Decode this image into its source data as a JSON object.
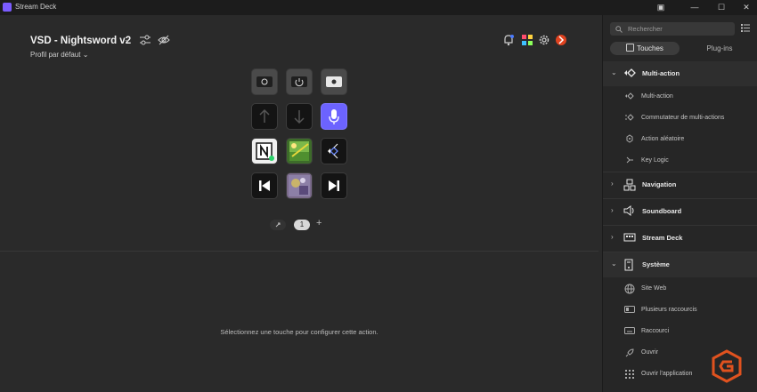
{
  "app": {
    "title": "Stream Deck"
  },
  "window_controls": [
    {
      "name": "compact-mode-icon",
      "glyph": "▣"
    },
    {
      "name": "minimize-icon",
      "glyph": "—"
    },
    {
      "name": "maximize-icon",
      "glyph": "☐"
    },
    {
      "name": "close-icon",
      "glyph": "✕"
    }
  ],
  "profile": {
    "name": "VSD - Nightsword v2",
    "subtitle": "Profil par défaut ⌄"
  },
  "page": {
    "current": "1"
  },
  "hint": "Sélectionnez une touche pour configurer cette action.",
  "keys": [
    {
      "icon": "brightness-icon"
    },
    {
      "icon": "power-icon"
    },
    {
      "icon": "brightness-up-icon"
    },
    {
      "icon": "arrow-up-icon"
    },
    {
      "icon": "arrow-down-icon"
    },
    {
      "icon": "microphone-icon"
    },
    {
      "icon": "notion-icon"
    },
    {
      "icon": "image-editor-icon"
    },
    {
      "icon": "multi-action-icon"
    },
    {
      "icon": "previous-track-icon"
    },
    {
      "icon": "album-art-icon"
    },
    {
      "icon": "next-track-icon"
    }
  ],
  "sidebar": {
    "search_placeholder": "Rechercher",
    "tabs": [
      {
        "label": "Touches"
      },
      {
        "label": "Plug-ins"
      }
    ],
    "categories": {
      "multi_action": {
        "label": "Multi-action",
        "expanded": true,
        "items": [
          {
            "label": "Multi-action"
          },
          {
            "label": "Commutateur de multi-actions"
          },
          {
            "label": "Action aléatoire"
          },
          {
            "label": "Key Logic"
          }
        ]
      },
      "navigation": {
        "label": "Navigation"
      },
      "soundboard": {
        "label": "Soundboard"
      },
      "stream_deck": {
        "label": "Stream Deck"
      },
      "systeme": {
        "label": "Système",
        "expanded": true,
        "items": [
          {
            "label": "Site Web"
          },
          {
            "label": "Plusieurs raccourcis"
          },
          {
            "label": "Raccourci"
          },
          {
            "label": "Ouvrir"
          },
          {
            "label": "Ouvrir l'application"
          }
        ]
      }
    }
  },
  "colors": {
    "accent": "#6c63ff",
    "background": "#2a2a2a",
    "sidebar": "#262626",
    "watermark": "#e0521f"
  }
}
